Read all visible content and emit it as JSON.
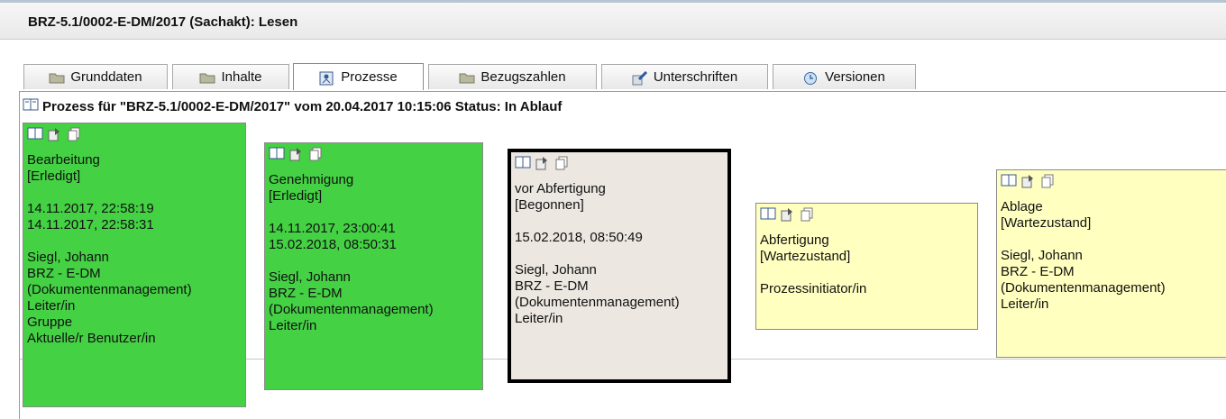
{
  "window": {
    "title": "BRZ-5.1/0002-E-DM/2017 (Sachakt): Lesen"
  },
  "tabs": [
    {
      "label": "Grunddaten",
      "icon": "folder-icon"
    },
    {
      "label": "Inhalte",
      "icon": "folder-icon"
    },
    {
      "label": "Prozesse",
      "icon": "process-icon"
    },
    {
      "label": "Bezugszahlen",
      "icon": "folder-icon"
    },
    {
      "label": "Unterschriften",
      "icon": "signature-icon"
    },
    {
      "label": "Versionen",
      "icon": "versions-icon"
    }
  ],
  "process": {
    "heading": "Prozess für \"BRZ-5.1/0002-E-DM/2017\" vom 20.04.2017 10:15:06 Status: In Ablauf"
  },
  "steps": [
    {
      "name": "Bearbeitung",
      "status": "[Erledigt]",
      "date1": "14.11.2017, 22:58:19",
      "date2": "14.11.2017, 22:58:31",
      "person": "Siegl, Johann",
      "org1": "BRZ - E-DM",
      "org2": "(Dokumentenmanagement)",
      "role": "Leiter/in",
      "extra1": "Gruppe",
      "extra2": "Aktuelle/r Benutzer/in"
    },
    {
      "name": "Genehmigung",
      "status": "[Erledigt]",
      "date1": "14.11.2017, 23:00:41",
      "date2": "15.02.2018, 08:50:31",
      "person": "Siegl, Johann",
      "org1": "BRZ - E-DM",
      "org2": "(Dokumentenmanagement)",
      "role": "Leiter/in"
    },
    {
      "name": "vor Abfertigung",
      "status": "[Begonnen]",
      "date1": "15.02.2018, 08:50:49",
      "person": "Siegl, Johann",
      "org1": "BRZ - E-DM",
      "org2": "(Dokumentenmanagement)",
      "role": "Leiter/in"
    },
    {
      "name": "Abfertigung",
      "status": "[Wartezustand]",
      "role": "Prozessinitiator/in"
    },
    {
      "name": "Ablage",
      "status": "[Wartezustand]",
      "person": "Siegl, Johann",
      "org1": "BRZ - E-DM",
      "org2": "(Dokumentenmanagement)",
      "role": "Leiter/in"
    }
  ]
}
